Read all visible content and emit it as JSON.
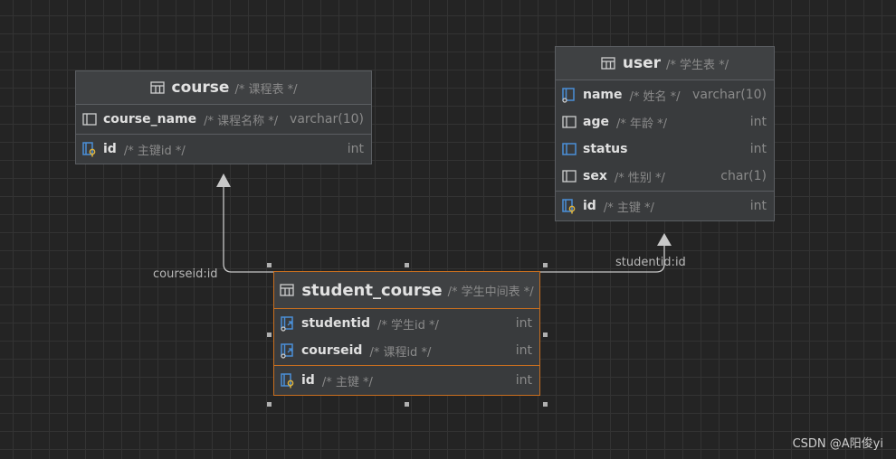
{
  "tables": {
    "course": {
      "name": "course",
      "comment": "/* 课程表 */",
      "columns": [
        {
          "name": "course_name",
          "comment": "/* 课程名称 */",
          "type": "varchar(10)"
        }
      ],
      "keys": [
        {
          "name": "id",
          "comment": "/* 主键id */",
          "type": "int"
        }
      ]
    },
    "user": {
      "name": "user",
      "comment": "/* 学生表 */",
      "columns": [
        {
          "name": "name",
          "comment": "/* 姓名 */",
          "type": "varchar(10)"
        },
        {
          "name": "age",
          "comment": "/* 年龄 */",
          "type": "int"
        },
        {
          "name": "status",
          "comment": "",
          "type": "int"
        },
        {
          "name": "sex",
          "comment": "/* 性别 */",
          "type": "char(1)"
        }
      ],
      "keys": [
        {
          "name": "id",
          "comment": "/* 主键 */",
          "type": "int"
        }
      ]
    },
    "student_course": {
      "name": "student_course",
      "comment": "/* 学生中间表 */",
      "columns": [
        {
          "name": "studentid",
          "comment": "/* 学生id */",
          "type": "int"
        },
        {
          "name": "courseid",
          "comment": "/* 课程id */",
          "type": "int"
        }
      ],
      "keys": [
        {
          "name": "id",
          "comment": "/* 主键 */",
          "type": "int"
        }
      ]
    }
  },
  "edges": {
    "courseid_label": "courseid:id",
    "studentid_label": "studentid:id"
  },
  "watermark": "CSDN @A阳俊yi",
  "colors": {
    "background": "#242424",
    "table_bg": "#393b3d",
    "selected_border": "#c96f1f",
    "key_icon": "#e0b43c",
    "fk_icon": "#4a8fd8"
  }
}
